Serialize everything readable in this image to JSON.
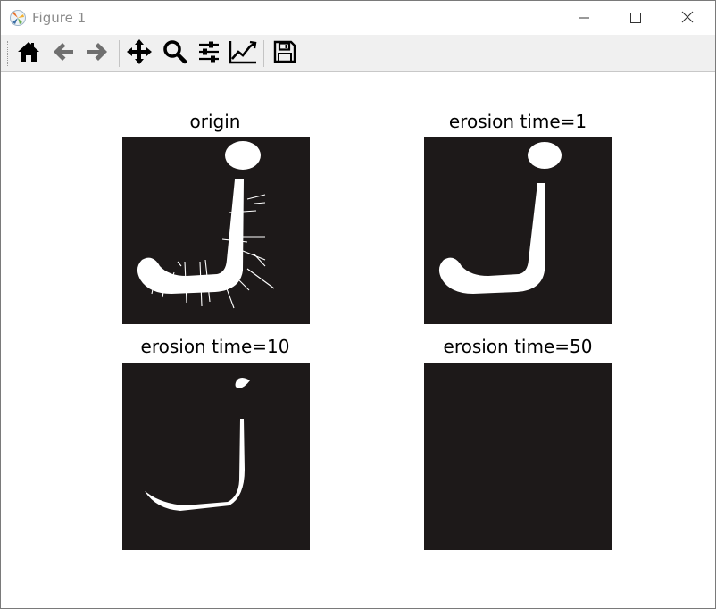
{
  "window": {
    "title": "Figure 1",
    "icon": "matplotlib-icon",
    "controls": [
      "minimize-icon",
      "maximize-icon",
      "close-icon"
    ]
  },
  "toolbar": {
    "buttons": [
      {
        "icon": "home-icon",
        "tooltip": "Reset original view"
      },
      {
        "icon": "back-arrow-icon",
        "tooltip": "Back to previous view"
      },
      {
        "icon": "forward-arrow-icon",
        "tooltip": "Forward to next view"
      },
      {
        "icon": "pan-icon",
        "tooltip": "Pan axes"
      },
      {
        "icon": "zoom-icon",
        "tooltip": "Zoom to rectangle"
      },
      {
        "icon": "configure-subplots-icon",
        "tooltip": "Configure subplots"
      },
      {
        "icon": "edit-axis-icon",
        "tooltip": "Edit axis, curve and image parameters"
      },
      {
        "icon": "save-icon",
        "tooltip": "Save the figure"
      }
    ]
  },
  "figure": {
    "subplots": [
      {
        "title": "origin",
        "image": "letter j with thin hair-like strokes"
      },
      {
        "title": "erosion time=1",
        "image": "letter j, strokes removed"
      },
      {
        "title": "erosion time=10",
        "image": "thin letter j outline"
      },
      {
        "title": "erosion time=50",
        "image": "empty black image"
      }
    ],
    "colors": {
      "image_background": "#1d1919",
      "foreground": "#ffffff"
    }
  }
}
